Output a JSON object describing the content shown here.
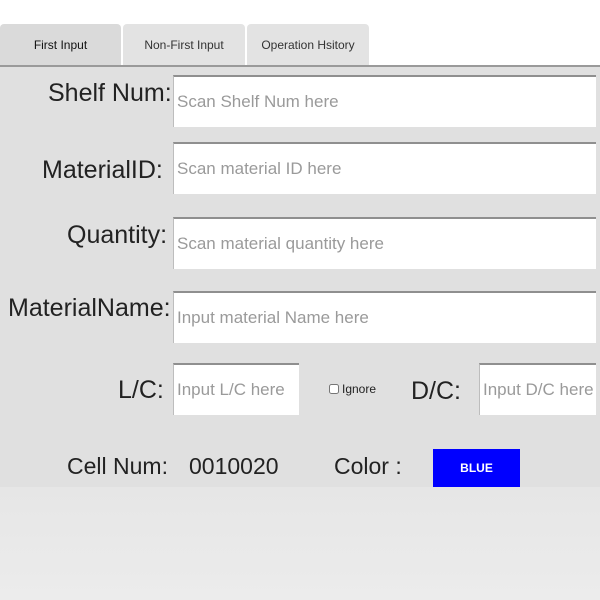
{
  "tabs": [
    {
      "label": "First Input"
    },
    {
      "label": "Non-First Input"
    },
    {
      "label": "Operation Hsitory"
    }
  ],
  "form": {
    "shelf_num": {
      "label": "Shelf Num:",
      "placeholder": "Scan Shelf Num here",
      "value": ""
    },
    "material_id": {
      "label": "MaterialID:",
      "placeholder": "Scan material ID here",
      "value": ""
    },
    "quantity": {
      "label": "Quantity:",
      "placeholder": "Scan material quantity here",
      "value": ""
    },
    "material_name": {
      "label": "MaterialName:",
      "placeholder": "Input material Name here",
      "value": ""
    },
    "lc": {
      "label": "L/C:",
      "placeholder": "Input L/C here",
      "value": ""
    },
    "ignore": {
      "label": "Ignore",
      "checked": false
    },
    "dc": {
      "label": "D/C:",
      "placeholder": "Input D/C here",
      "value": ""
    }
  },
  "info": {
    "cell_num_label": "Cell Num:",
    "cell_num_value": "0010020",
    "color_label": "Color :",
    "color_button_label": "BLUE",
    "color_value": "#0000ff"
  }
}
